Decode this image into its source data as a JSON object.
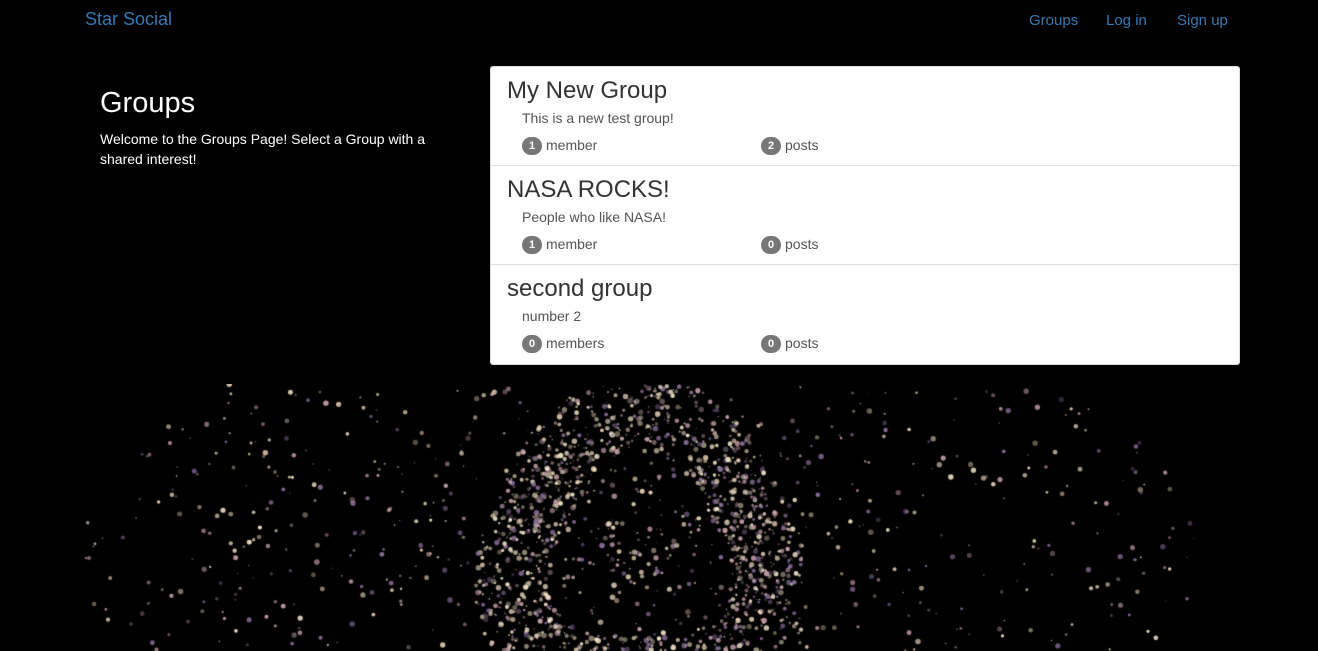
{
  "navbar": {
    "brand": "Star Social",
    "links": [
      "Groups",
      "Log in",
      "Sign up"
    ]
  },
  "intro": {
    "title": "Groups",
    "text": "Welcome to the Groups Page! Select a Group with a shared interest!"
  },
  "groups": [
    {
      "name": "My New Group",
      "description": "This is a new test group!",
      "member_count": "1",
      "member_label": "member",
      "post_count": "2",
      "post_label": "posts"
    },
    {
      "name": "NASA ROCKS!",
      "description": "People who like NASA!",
      "member_count": "1",
      "member_label": "member",
      "post_count": "0",
      "post_label": "posts"
    },
    {
      "name": "second group",
      "description": "number 2",
      "member_count": "0",
      "member_label": "members",
      "post_count": "0",
      "post_label": "posts"
    }
  ],
  "colors": {
    "background": "#000000",
    "link": "#337ab7",
    "badge": "#777777",
    "particle_tones": [
      "#f3e6c8",
      "#c8a0a8",
      "#8a6f9a",
      "#e7d3b8"
    ]
  }
}
